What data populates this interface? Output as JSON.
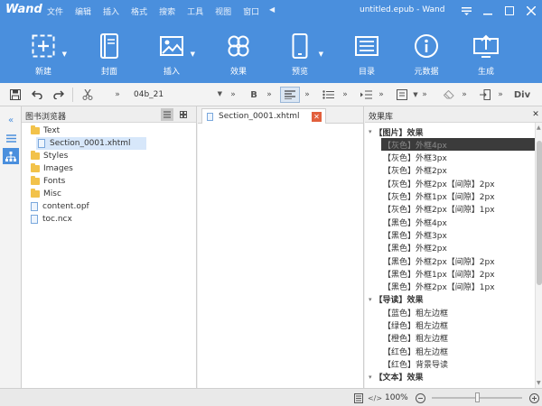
{
  "titlebar": {
    "brand": "Wand",
    "menu": [
      "文件",
      "编辑",
      "插入",
      "格式",
      "搜索",
      "工具",
      "视图",
      "窗口"
    ],
    "window_title": "untitled.epub - Wand"
  },
  "ribbon": {
    "buttons": [
      {
        "label": "新建",
        "icon": "new-icon"
      },
      {
        "label": "封面",
        "icon": "cover-book-icon"
      },
      {
        "label": "插入",
        "icon": "image-icon"
      },
      {
        "label": "效果",
        "icon": "clover-icon"
      },
      {
        "label": "预览",
        "icon": "phone-icon"
      },
      {
        "label": "目录",
        "icon": "toc-list-icon"
      },
      {
        "label": "元数据",
        "icon": "info-icon"
      },
      {
        "label": "生成",
        "icon": "export-screen-icon"
      }
    ]
  },
  "toolbar": {
    "style_combo": "04b_21",
    "bold": "B",
    "div": "Div"
  },
  "browser": {
    "title": "图书浏览器",
    "items": [
      {
        "label": "Text",
        "kind": "folder",
        "level": 0
      },
      {
        "label": "Section_0001.xhtml",
        "kind": "file",
        "level": 1
      },
      {
        "label": "Styles",
        "kind": "folder",
        "level": 0
      },
      {
        "label": "Images",
        "kind": "folder",
        "level": 0
      },
      {
        "label": "Fonts",
        "kind": "folder",
        "level": 0
      },
      {
        "label": "Misc",
        "kind": "folder",
        "level": 0
      },
      {
        "label": "content.opf",
        "kind": "file",
        "level": 0
      },
      {
        "label": "toc.ncx",
        "kind": "file",
        "level": 0
      }
    ]
  },
  "editor": {
    "tab_label": "Section_0001.xhtml"
  },
  "effects": {
    "title": "效果库",
    "items": [
      {
        "label": "【图片】效果",
        "group": true
      },
      {
        "label": "【灰色】外框4px",
        "highlight": true
      },
      {
        "label": "【灰色】外框3px"
      },
      {
        "label": "【灰色】外框2px"
      },
      {
        "label": "【灰色】外框2px【间隙】2px"
      },
      {
        "label": "【灰色】外框1px【间隙】2px"
      },
      {
        "label": "【灰色】外框2px【间隙】1px"
      },
      {
        "label": "【黑色】外框4px"
      },
      {
        "label": "【黑色】外框3px"
      },
      {
        "label": "【黑色】外框2px"
      },
      {
        "label": "【黑色】外框2px【间隙】2px"
      },
      {
        "label": "【黑色】外框1px【间隙】2px"
      },
      {
        "label": "【黑色】外框2px【间隙】1px"
      },
      {
        "label": "【导读】效果",
        "group": true
      },
      {
        "label": "【蓝色】粗左边框"
      },
      {
        "label": "【绿色】粗左边框"
      },
      {
        "label": "【橙色】粗左边框"
      },
      {
        "label": "【红色】粗左边框"
      },
      {
        "label": "【红色】背景导读"
      },
      {
        "label": "【文本】效果",
        "group": true
      }
    ]
  },
  "status": {
    "zoom": "100%"
  },
  "colors": {
    "accent": "#4a8fdd",
    "highlight_bg": "#3b3b3b",
    "close_tab": "#e25f3c",
    "folder": "#f2c24a"
  }
}
